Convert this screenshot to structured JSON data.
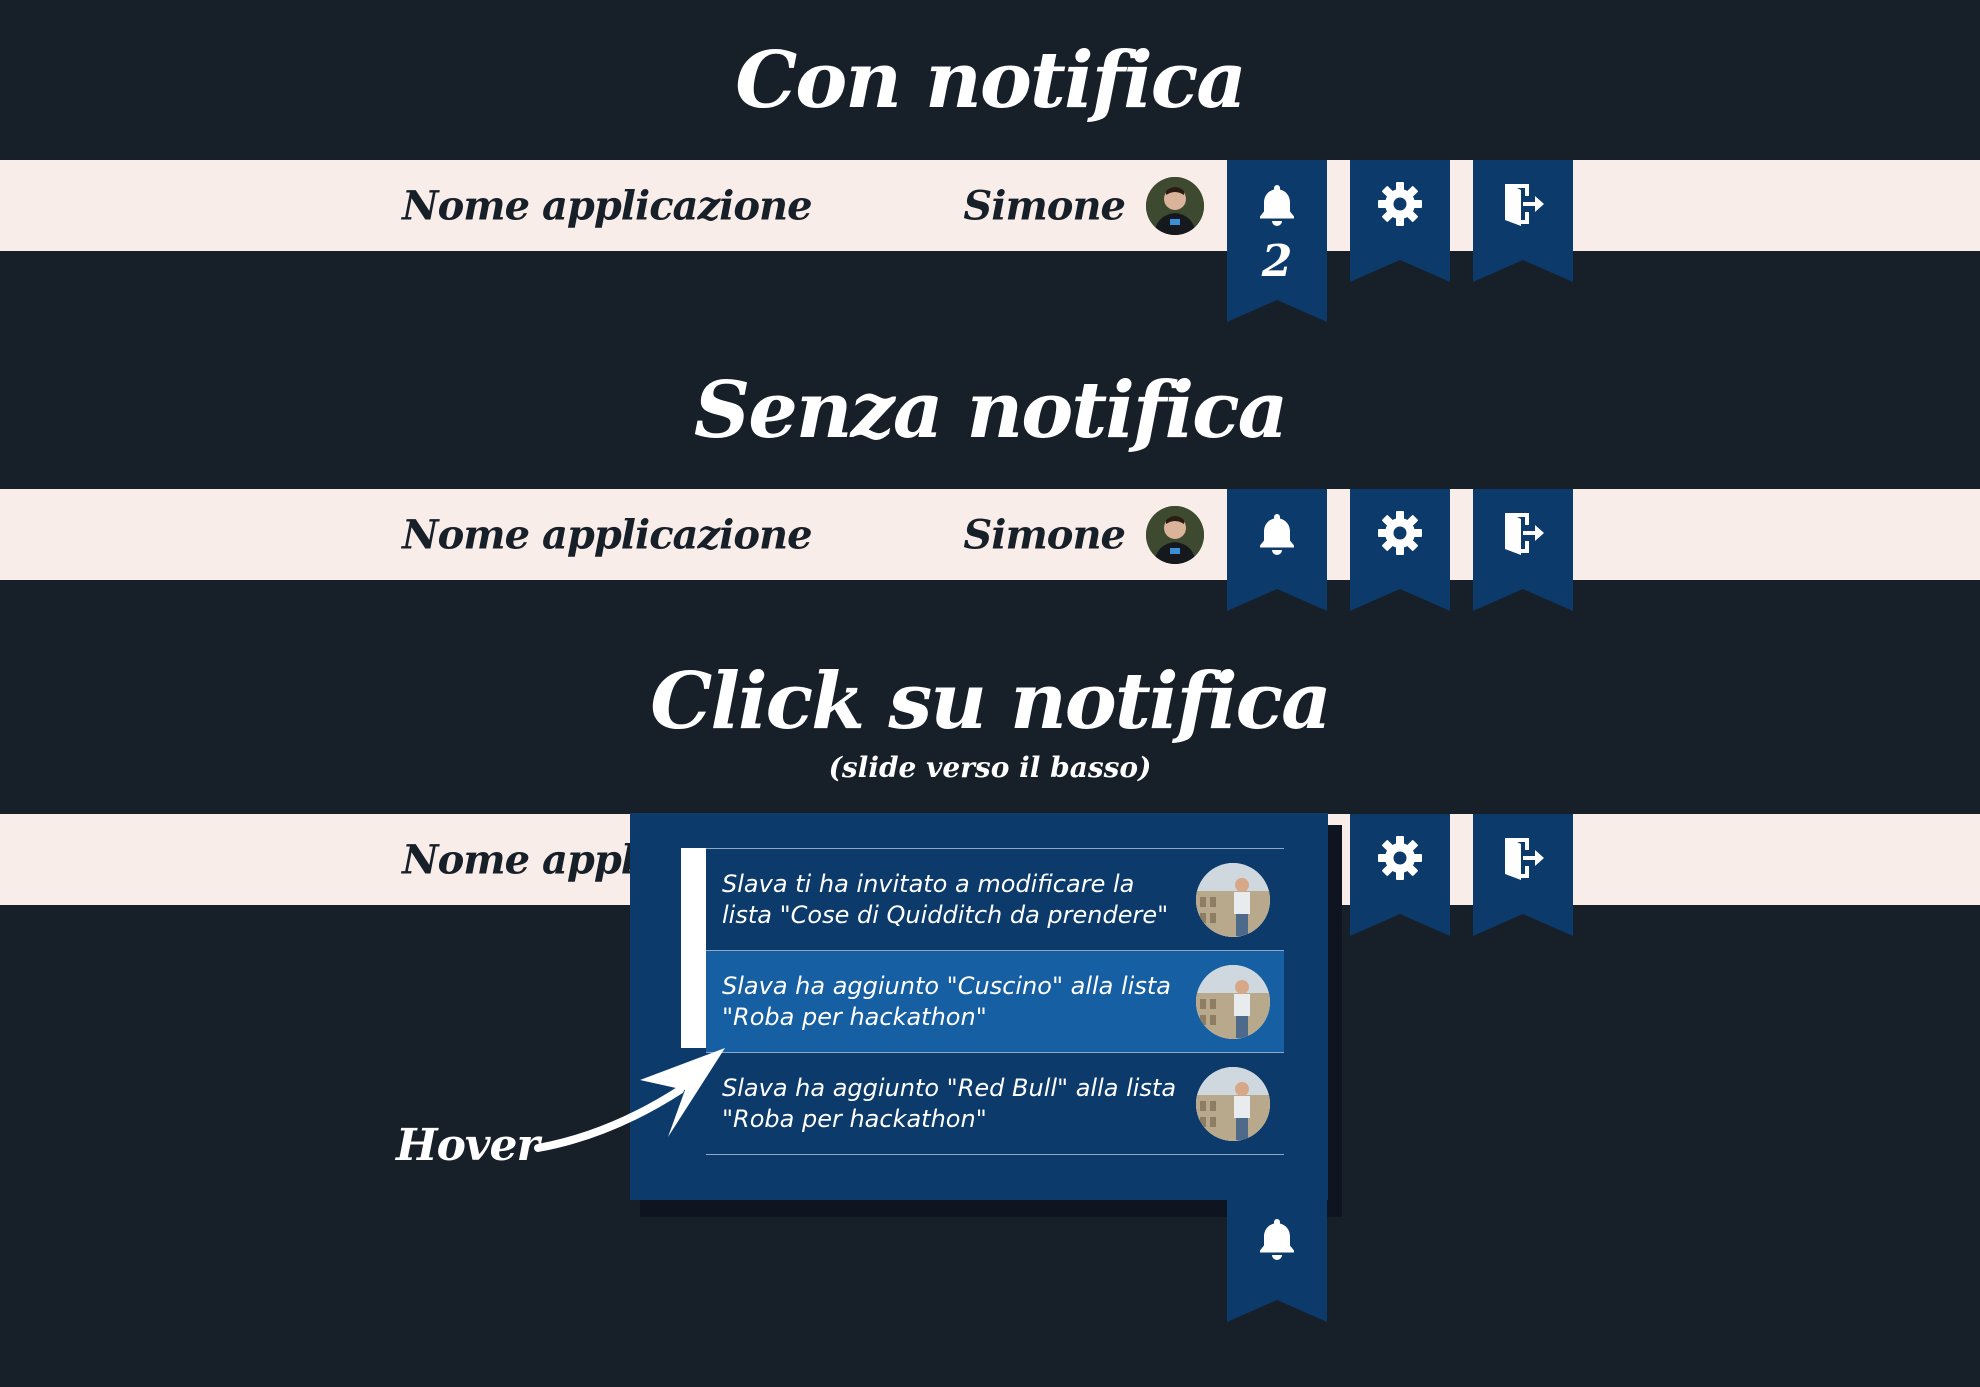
{
  "sections": [
    {
      "title": "Con notifica"
    },
    {
      "title": "Senza notifica"
    },
    {
      "title": "Click su notifica",
      "subtitle": "(slide verso il basso)"
    }
  ],
  "header": {
    "app_name": "Nome applicazione",
    "user_name": "Simone",
    "notification_count": "2",
    "icons": {
      "notifications": "bell-icon",
      "settings": "gear-icon",
      "logout": "logout-icon"
    }
  },
  "notifications": [
    {
      "text": "Slava ti ha invitato a modificare la\nlista \"Cose di Quidditch da prendere\""
    },
    {
      "text": "Slava ha aggiunto \"Cuscino\" alla lista\n\"Roba per hackathon\""
    },
    {
      "text": "Slava ha aggiunto \"Red Bull\" alla lista\n\"Roba per hackathon\""
    }
  ],
  "annotation": {
    "label": "Hover"
  },
  "colors": {
    "background": "#171f29",
    "header_bar": "#f8ede8",
    "ribbon": "#0b3a6b",
    "hover": "#175fa3",
    "text_light": "#ffffff",
    "text_dark": "#171f29"
  }
}
